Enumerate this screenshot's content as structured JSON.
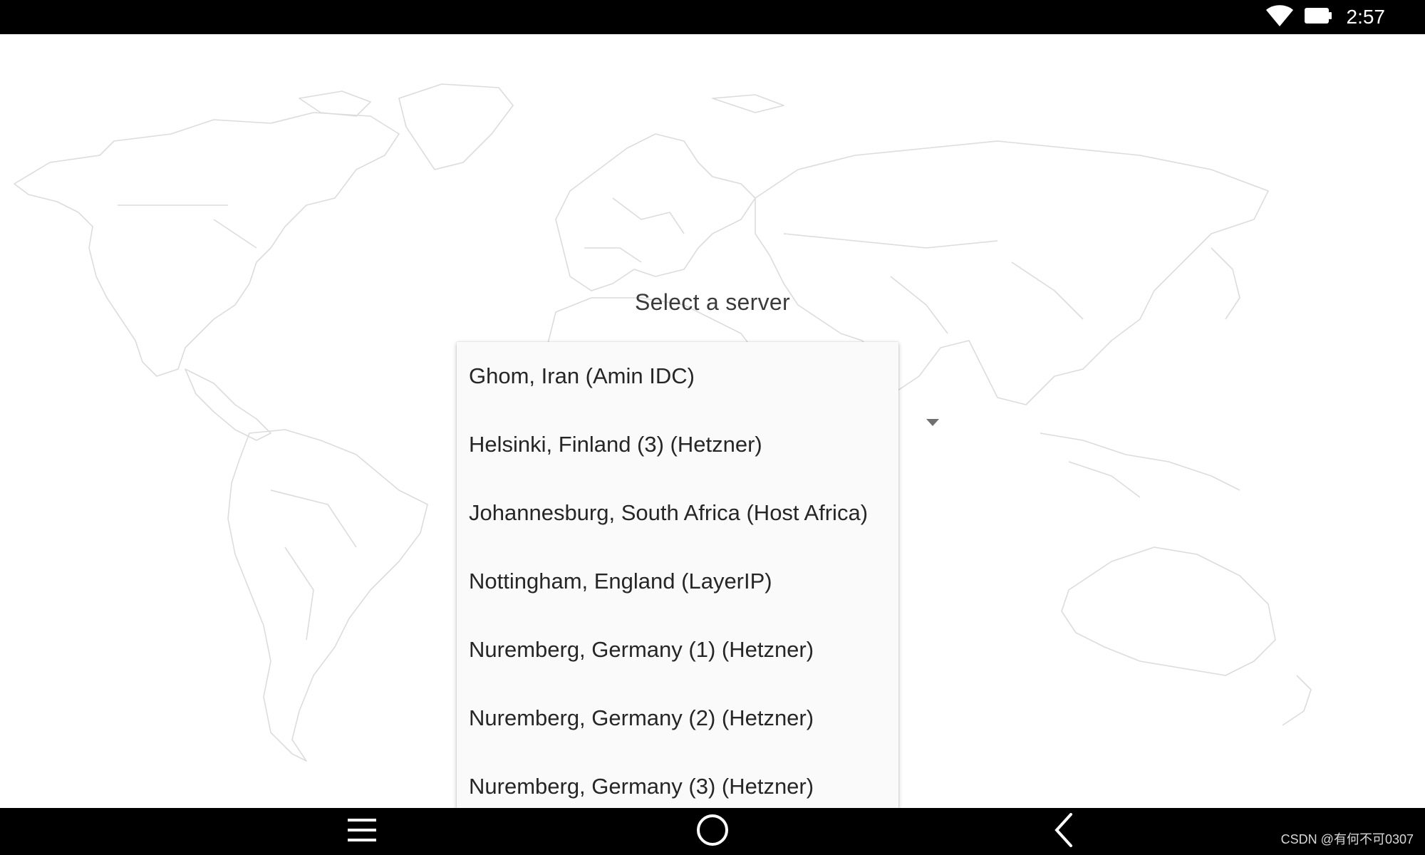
{
  "status_bar": {
    "time": "2:57",
    "icons": [
      "wifi-icon",
      "battery-icon"
    ]
  },
  "dialog": {
    "title": "Select a server",
    "options": [
      "Ghom, Iran (Amin IDC)",
      "Helsinki, Finland (3) (Hetzner)",
      "Johannesburg, South Africa (Host Africa)",
      "Nottingham, England (LayerIP)",
      "Nuremberg, Germany (1) (Hetzner)",
      "Nuremberg, Germany (2) (Hetzner)",
      "Nuremberg, Germany (3) (Hetzner)"
    ]
  },
  "nav_bar": {
    "icons": [
      "menu-icon",
      "home-icon",
      "back-icon"
    ]
  },
  "watermark": "CSDN @有何不可0307",
  "colors": {
    "bars": "#000000",
    "background": "#ffffff",
    "map_lines": "#dcdcdc",
    "dropdown_bg": "#fafafa",
    "text": "#262626"
  }
}
